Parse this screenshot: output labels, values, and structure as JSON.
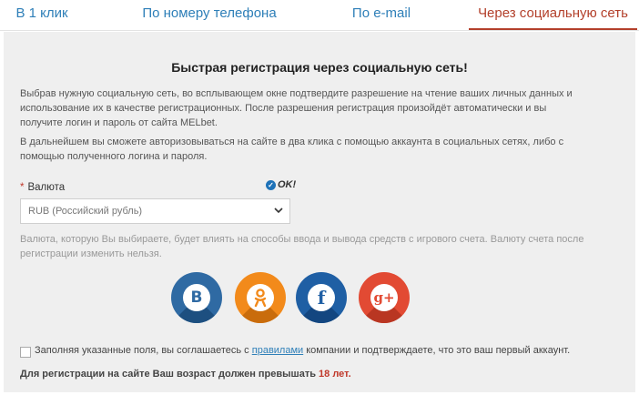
{
  "tabs": [
    {
      "label": "В 1 клик"
    },
    {
      "label": "По номеру телефона"
    },
    {
      "label": "По e-mail"
    },
    {
      "label": "Через социальную сеть",
      "active": true
    }
  ],
  "panel": {
    "title": "Быстрая регистрация через социальную сеть!",
    "para1": "Выбрав нужную социальную сеть, во всплывающем окне подтвердите разрешение на чтение ваших личных данных и использование их в качестве регистрационных. После разрешения регистрация произойдёт автоматически и вы получите логин и пароль от сайта MELbet.",
    "para2": "В дальнейшем вы сможете авторизовываться на сайте в два клика с помощью аккаунта в социальных сетях, либо с помощью полученного логина и пароля.",
    "currency_label": "Валюта",
    "currency_required": "*",
    "ok_text": "OK!",
    "currency_value": "RUB (Российский рубль)",
    "currency_note": "Валюта, которую Вы выбираете, будет влиять на способы ввода и вывода средств с игрового счета. Валюту счета после регистрации изменить нельзя.",
    "agree_pre": "Заполняя указанные поля, вы соглашаетесь с ",
    "agree_link": "правилами",
    "agree_post": " компании и подтверждаете, что это ваш первый аккаунт.",
    "age_pre": "Для регистрации на сайте Ваш возраст должен превышать ",
    "age_value": "18 лет."
  },
  "social": [
    {
      "name": "vk",
      "glyph": "B",
      "color": "#2f6aa3",
      "dark": "#1d4f80",
      "icon_color": "#2f6aa3"
    },
    {
      "name": "odnoklassniki",
      "glyph": "ok",
      "color": "#f28a1b",
      "dark": "#c96c0c",
      "icon_color": "#f28a1b"
    },
    {
      "name": "facebook",
      "glyph": "f",
      "color": "#1f5fa4",
      "dark": "#134680",
      "icon_color": "#1f5fa4"
    },
    {
      "name": "google-plus",
      "glyph": "g+",
      "color": "#e24a33",
      "dark": "#b93622",
      "icon_color": "#e24a33"
    }
  ],
  "colors": {
    "accent": "#b3402b",
    "link": "#2e7fb8"
  }
}
